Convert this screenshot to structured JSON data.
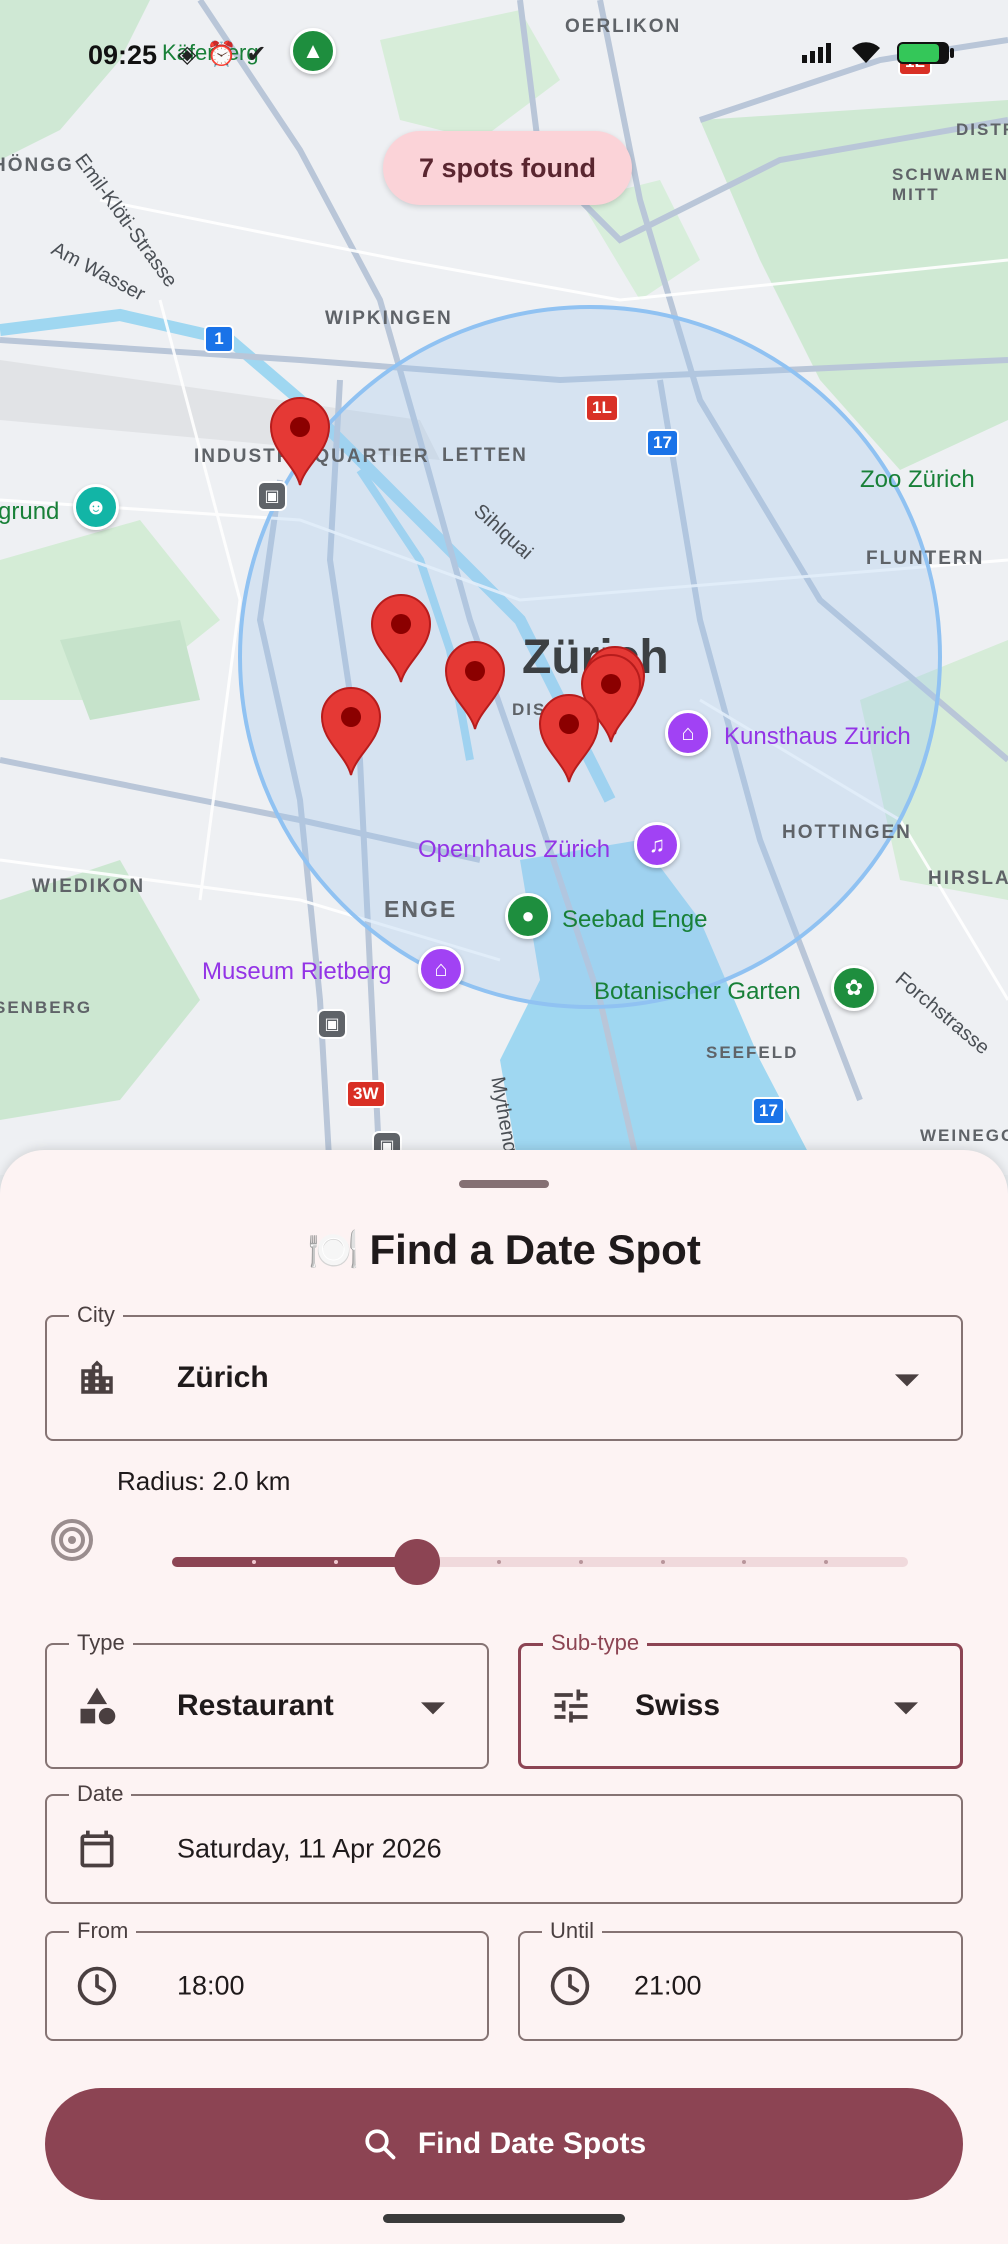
{
  "status_bar": {
    "time": "09:25"
  },
  "map": {
    "spots_found": "7 spots found",
    "area_labels": [
      "OERLIKON",
      "HÖNGG",
      "WIPKINGEN",
      "INDUSTRIEQUARTIER",
      "LETTEN",
      "FLUNTERN",
      "HOTTINGEN",
      "WIEDIKON",
      "ENGE",
      "HIRSLAN",
      "SEEFELD",
      "WEINEGG",
      "SCHWAMEN MITT",
      "DISTR",
      "SENBERG",
      "DIS"
    ],
    "street_labels": [
      "Emil-Klöti-Strasse",
      "Am Wasser",
      "Sihlquai",
      "Mythenq",
      "Forchstrasse",
      "Käferberg"
    ],
    "city_label": "Zürich",
    "pois": [
      {
        "name": "Zoo Zürich",
        "color": "green"
      },
      {
        "name": "Kunsthaus Zürich",
        "color": "purple"
      },
      {
        "name": "Opernhaus Zürich",
        "color": "purple"
      },
      {
        "name": "Seebad Enge",
        "color": "green"
      },
      {
        "name": "Museum Rietberg",
        "color": "purple"
      },
      {
        "name": "Botanischer Garten",
        "color": "green"
      },
      {
        "name": "grund",
        "color": "green"
      }
    ],
    "road_shields": [
      "1",
      "1L",
      "17",
      "3W",
      "17",
      "1L"
    ],
    "spot_count": 7
  },
  "sheet": {
    "title": "Find a Date Spot",
    "title_emoji": "🍽️",
    "city": {
      "label": "City",
      "value": "Zürich"
    },
    "radius": {
      "label": "Radius: 2.0 km",
      "value_km": 2.0,
      "min_km": 0.5,
      "max_km": 5.0,
      "fraction": 0.333,
      "steps": 9
    },
    "type": {
      "label": "Type",
      "value": "Restaurant"
    },
    "subtype": {
      "label": "Sub-type",
      "value": "Swiss"
    },
    "date": {
      "label": "Date",
      "value": "Saturday, 11 Apr 2026"
    },
    "from": {
      "label": "From",
      "value": "18:00"
    },
    "until": {
      "label": "Until",
      "value": "21:00"
    },
    "find_button": "Find Date Spots"
  },
  "colors": {
    "primary": "#8c4453",
    "chip": "#fbd3d8",
    "sheet_bg": "#fdf3f3",
    "pin": "#e53935",
    "radius_circle": "#90c2f2"
  },
  "icons": [
    "building-icon",
    "radius-icon",
    "shapes-icon",
    "tune-icon",
    "calendar-icon",
    "clock-icon",
    "search-icon",
    "dropdown-arrow-icon"
  ]
}
